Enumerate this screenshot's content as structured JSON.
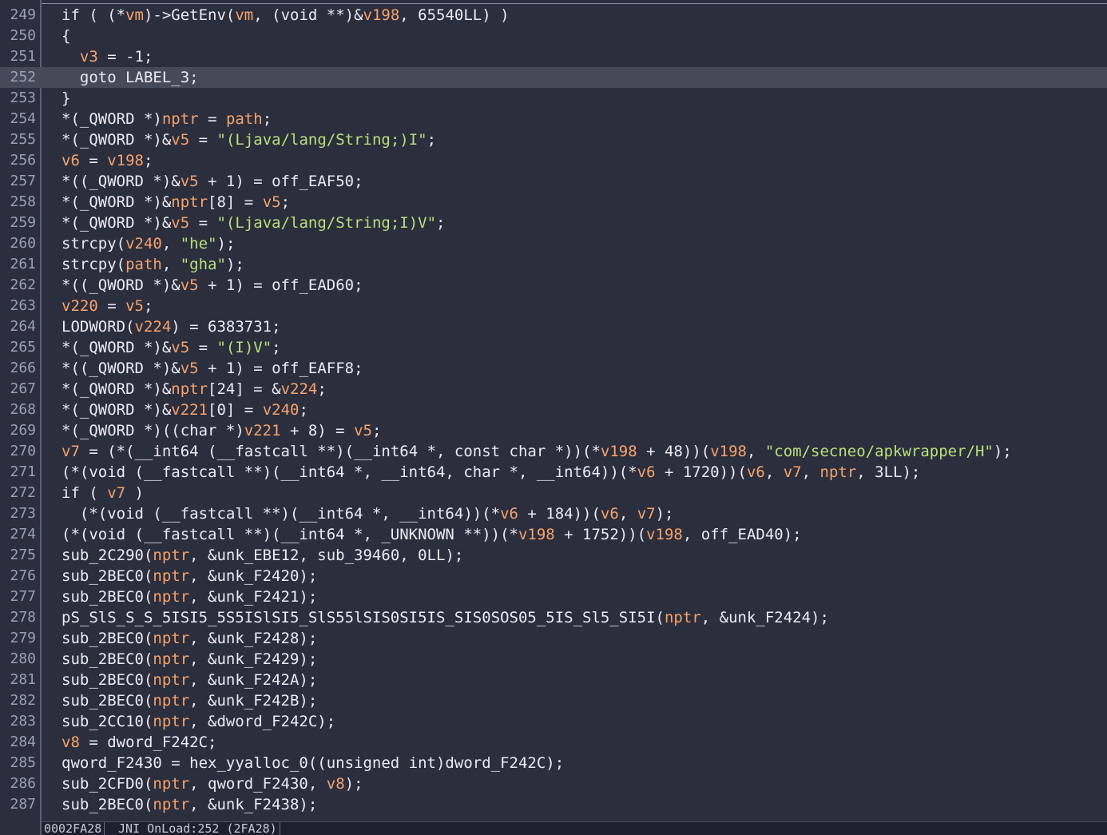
{
  "editor": {
    "current_line": 252,
    "lines": [
      {
        "n": "249",
        "parts": [
          [
            "t",
            "if ( (*"
          ],
          [
            "v",
            "vm"
          ],
          [
            "t",
            ")->GetEnv("
          ],
          [
            "v",
            "vm"
          ],
          [
            "t",
            ", (void **)&"
          ],
          [
            "v",
            "v198"
          ],
          [
            "t",
            ", 65540LL) )"
          ]
        ]
      },
      {
        "n": "250",
        "parts": [
          [
            "t",
            "{"
          ]
        ]
      },
      {
        "n": "251",
        "parts": [
          [
            "t",
            "  "
          ],
          [
            "v",
            "v3"
          ],
          [
            "t",
            " = -1;"
          ]
        ]
      },
      {
        "n": "252",
        "parts": [
          [
            "t",
            "  goto LABEL_3;"
          ]
        ]
      },
      {
        "n": "253",
        "parts": [
          [
            "t",
            "}"
          ]
        ]
      },
      {
        "n": "254",
        "parts": [
          [
            "t",
            "*(_QWORD *)"
          ],
          [
            "v",
            "nptr"
          ],
          [
            "t",
            " = "
          ],
          [
            "v",
            "path"
          ],
          [
            "t",
            ";"
          ]
        ]
      },
      {
        "n": "255",
        "parts": [
          [
            "t",
            "*(_QWORD *)&"
          ],
          [
            "v",
            "v5"
          ],
          [
            "t",
            " = "
          ],
          [
            "s",
            "\"(Ljava/lang/String;)I\""
          ],
          [
            "t",
            ";"
          ]
        ]
      },
      {
        "n": "256",
        "parts": [
          [
            "v",
            "v6"
          ],
          [
            "t",
            " = "
          ],
          [
            "v",
            "v198"
          ],
          [
            "t",
            ";"
          ]
        ]
      },
      {
        "n": "257",
        "parts": [
          [
            "t",
            "*((_QWORD *)&"
          ],
          [
            "v",
            "v5"
          ],
          [
            "t",
            " + 1) = off_EAF50;"
          ]
        ]
      },
      {
        "n": "258",
        "parts": [
          [
            "t",
            "*(_QWORD *)&"
          ],
          [
            "v",
            "nptr"
          ],
          [
            "t",
            "[8] = "
          ],
          [
            "v",
            "v5"
          ],
          [
            "t",
            ";"
          ]
        ]
      },
      {
        "n": "259",
        "parts": [
          [
            "t",
            "*(_QWORD *)&"
          ],
          [
            "v",
            "v5"
          ],
          [
            "t",
            " = "
          ],
          [
            "s",
            "\"(Ljava/lang/String;I)V\""
          ],
          [
            "t",
            ";"
          ]
        ]
      },
      {
        "n": "260",
        "parts": [
          [
            "t",
            "strcpy("
          ],
          [
            "v",
            "v240"
          ],
          [
            "t",
            ", "
          ],
          [
            "s",
            "\"he\""
          ],
          [
            "t",
            ");"
          ]
        ]
      },
      {
        "n": "261",
        "parts": [
          [
            "t",
            "strcpy("
          ],
          [
            "v",
            "path"
          ],
          [
            "t",
            ", "
          ],
          [
            "s",
            "\"gha\""
          ],
          [
            "t",
            ");"
          ]
        ]
      },
      {
        "n": "262",
        "parts": [
          [
            "t",
            "*((_QWORD *)&"
          ],
          [
            "v",
            "v5"
          ],
          [
            "t",
            " + 1) = off_EAD60;"
          ]
        ]
      },
      {
        "n": "263",
        "parts": [
          [
            "v",
            "v220"
          ],
          [
            "t",
            " = "
          ],
          [
            "v",
            "v5"
          ],
          [
            "t",
            ";"
          ]
        ]
      },
      {
        "n": "264",
        "parts": [
          [
            "t",
            "LODWORD("
          ],
          [
            "v",
            "v224"
          ],
          [
            "t",
            ") = 6383731;"
          ]
        ]
      },
      {
        "n": "265",
        "parts": [
          [
            "t",
            "*(_QWORD *)&"
          ],
          [
            "v",
            "v5"
          ],
          [
            "t",
            " = "
          ],
          [
            "s",
            "\"(I)V\""
          ],
          [
            "t",
            ";"
          ]
        ]
      },
      {
        "n": "266",
        "parts": [
          [
            "t",
            "*((_QWORD *)&"
          ],
          [
            "v",
            "v5"
          ],
          [
            "t",
            " + 1) = off_EAFF8;"
          ]
        ]
      },
      {
        "n": "267",
        "parts": [
          [
            "t",
            "*(_QWORD *)&"
          ],
          [
            "v",
            "nptr"
          ],
          [
            "t",
            "[24] = &"
          ],
          [
            "v",
            "v224"
          ],
          [
            "t",
            ";"
          ]
        ]
      },
      {
        "n": "268",
        "parts": [
          [
            "t",
            "*(_QWORD *)&"
          ],
          [
            "v",
            "v221"
          ],
          [
            "t",
            "[0] = "
          ],
          [
            "v",
            "v240"
          ],
          [
            "t",
            ";"
          ]
        ]
      },
      {
        "n": "269",
        "parts": [
          [
            "t",
            "*(_QWORD *)((char *)"
          ],
          [
            "v",
            "v221"
          ],
          [
            "t",
            " + 8) = "
          ],
          [
            "v",
            "v5"
          ],
          [
            "t",
            ";"
          ]
        ]
      },
      {
        "n": "270",
        "parts": [
          [
            "v",
            "v7"
          ],
          [
            "t",
            " = (*(__int64 (__fastcall **)(__int64 *, const char *))(*"
          ],
          [
            "v",
            "v198"
          ],
          [
            "t",
            " + 48))("
          ],
          [
            "v",
            "v198"
          ],
          [
            "t",
            ", "
          ],
          [
            "s",
            "\"com/secneo/apkwrapper/H\""
          ],
          [
            "t",
            ");"
          ]
        ]
      },
      {
        "n": "271",
        "parts": [
          [
            "t",
            "(*(void (__fastcall **)(__int64 *, __int64, char *, __int64))(*"
          ],
          [
            "v",
            "v6"
          ],
          [
            "t",
            " + 1720))("
          ],
          [
            "v",
            "v6"
          ],
          [
            "t",
            ", "
          ],
          [
            "v",
            "v7"
          ],
          [
            "t",
            ", "
          ],
          [
            "v",
            "nptr"
          ],
          [
            "t",
            ", 3LL);"
          ]
        ]
      },
      {
        "n": "272",
        "parts": [
          [
            "t",
            "if ( "
          ],
          [
            "v",
            "v7"
          ],
          [
            "t",
            " )"
          ]
        ]
      },
      {
        "n": "273",
        "parts": [
          [
            "t",
            "  (*(void (__fastcall **)(__int64 *, __int64))(*"
          ],
          [
            "v",
            "v6"
          ],
          [
            "t",
            " + 184))("
          ],
          [
            "v",
            "v6"
          ],
          [
            "t",
            ", "
          ],
          [
            "v",
            "v7"
          ],
          [
            "t",
            ");"
          ]
        ]
      },
      {
        "n": "274",
        "parts": [
          [
            "t",
            "(*(void (__fastcall **)(__int64 *, _UNKNOWN **))(*"
          ],
          [
            "v",
            "v198"
          ],
          [
            "t",
            " + 1752))("
          ],
          [
            "v",
            "v198"
          ],
          [
            "t",
            ", off_EAD40);"
          ]
        ]
      },
      {
        "n": "275",
        "parts": [
          [
            "t",
            "sub_2C290("
          ],
          [
            "v",
            "nptr"
          ],
          [
            "t",
            ", &unk_EBE12, sub_39460, 0LL);"
          ]
        ]
      },
      {
        "n": "276",
        "parts": [
          [
            "t",
            "sub_2BEC0("
          ],
          [
            "v",
            "nptr"
          ],
          [
            "t",
            ", &unk_F2420);"
          ]
        ]
      },
      {
        "n": "277",
        "parts": [
          [
            "t",
            "sub_2BEC0("
          ],
          [
            "v",
            "nptr"
          ],
          [
            "t",
            ", &unk_F2421);"
          ]
        ]
      },
      {
        "n": "278",
        "parts": [
          [
            "t",
            "pS_SlS_S_S_5ISI5_5S5ISlSI5_SlS55lSIS0SI5IS_SIS0SOS05_5IS_Sl5_SI5I("
          ],
          [
            "v",
            "nptr"
          ],
          [
            "t",
            ", &unk_F2424);"
          ]
        ]
      },
      {
        "n": "279",
        "parts": [
          [
            "t",
            "sub_2BEC0("
          ],
          [
            "v",
            "nptr"
          ],
          [
            "t",
            ", &unk_F2428);"
          ]
        ]
      },
      {
        "n": "280",
        "parts": [
          [
            "t",
            "sub_2BEC0("
          ],
          [
            "v",
            "nptr"
          ],
          [
            "t",
            ", &unk_F2429);"
          ]
        ]
      },
      {
        "n": "281",
        "parts": [
          [
            "t",
            "sub_2BEC0("
          ],
          [
            "v",
            "nptr"
          ],
          [
            "t",
            ", &unk_F242A);"
          ]
        ]
      },
      {
        "n": "282",
        "parts": [
          [
            "t",
            "sub_2BEC0("
          ],
          [
            "v",
            "nptr"
          ],
          [
            "t",
            ", &unk_F242B);"
          ]
        ]
      },
      {
        "n": "283",
        "parts": [
          [
            "t",
            "sub_2CC10("
          ],
          [
            "v",
            "nptr"
          ],
          [
            "t",
            ", &dword_F242C);"
          ]
        ]
      },
      {
        "n": "284",
        "parts": [
          [
            "v",
            "v8"
          ],
          [
            "t",
            " = dword_F242C;"
          ]
        ]
      },
      {
        "n": "285",
        "parts": [
          [
            "t",
            "qword_F2430 = hex_yyalloc_0((unsigned int)dword_F242C);"
          ]
        ]
      },
      {
        "n": "286",
        "parts": [
          [
            "t",
            "sub_2CFD0("
          ],
          [
            "v",
            "nptr"
          ],
          [
            "t",
            ", qword_F2430, "
          ],
          [
            "v",
            "v8"
          ],
          [
            "t",
            ");"
          ]
        ]
      },
      {
        "n": "287",
        "parts": [
          [
            "t",
            "sub_2BEC0("
          ],
          [
            "v",
            "nptr"
          ],
          [
            "t",
            ", &unk_F2438);"
          ]
        ]
      }
    ]
  },
  "status": {
    "address": "0002FA28",
    "location": "JNI_OnLoad:252 (2FA28)"
  },
  "colors": {
    "background": "#2b2e3d",
    "text": "#eceaf3",
    "variable": "#f7a36b",
    "string": "#b8e07a",
    "line_number": "#9aa0b2",
    "current_line": "#464957"
  }
}
